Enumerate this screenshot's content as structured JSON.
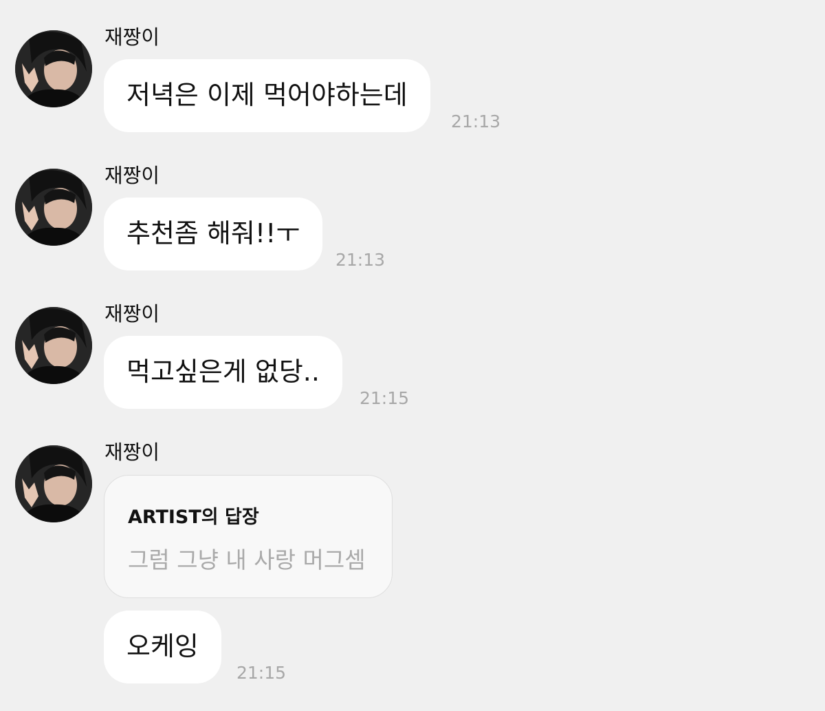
{
  "messages": [
    {
      "sender": "재짱이",
      "text": "저녁은 이제 먹어야하는데",
      "time": "21:13"
    },
    {
      "sender": "재짱이",
      "text": "추천좀 해줘!!ㅜ",
      "time": "21:13"
    },
    {
      "sender": "재짱이",
      "text": "먹고싶은게 없당..",
      "time": "21:15"
    }
  ],
  "reply_group": {
    "sender": "재짱이",
    "reply_heading": "ARTIST의 답장",
    "reply_text": "그럼 그냥 내 사랑 머그셈",
    "followup_text": "오케잉",
    "time": "21:15"
  },
  "colors": {
    "background": "#f0f0f0",
    "bubble": "#ffffff",
    "reply_card": "#f8f8f8",
    "timestamp": "#a7a7a7"
  },
  "icons": {
    "avatar": "profile-photo"
  }
}
